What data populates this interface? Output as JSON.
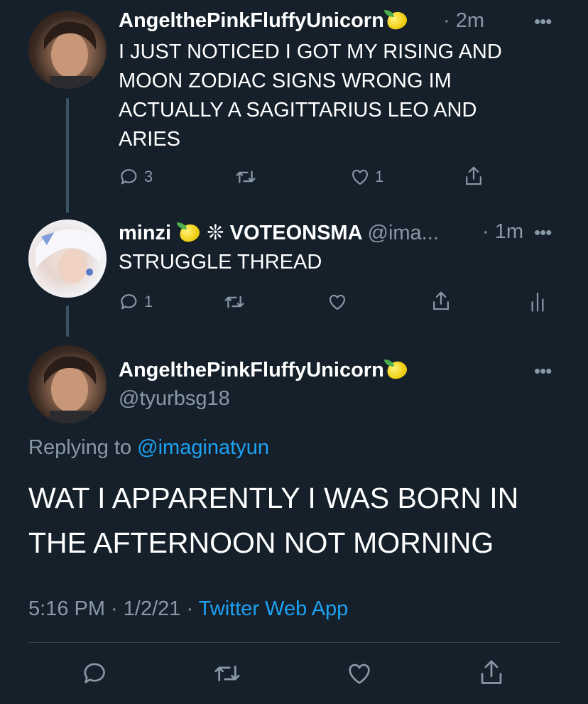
{
  "tweet1": {
    "display_name": "AngelthePinkFluffyUnicorn",
    "time": "· 2m",
    "text_lines": [
      "I JUST NOTICED I GOT MY RISING AND",
      "MOON ZODIAC SIGNS WRONG IM",
      "ACTUALLY A SAGITTARIUS LEO AND",
      "ARIES"
    ],
    "reply_count": "3",
    "like_count": "1"
  },
  "tweet2": {
    "display_name_a": "minzi",
    "display_name_b": "❊ VOTEONSMA",
    "handle": "@ima...",
    "time": "· 1m",
    "text": "STRUGGLE THREAD",
    "reply_count": "1"
  },
  "main_tweet": {
    "display_name": "AngelthePinkFluffyUnicorn",
    "handle": "@tyurbsg18",
    "replying_prefix": "Replying to",
    "replying_handle": "@imaginatyun",
    "text_lines": [
      "WAT I APPARENTLY I WAS BORN IN",
      "THE AFTERNOON NOT MORNING"
    ],
    "meta_time": "5:16 PM · 1/2/21 ·",
    "meta_source": "Twitter Web App"
  },
  "more_label": "•••",
  "colors": {
    "background": "#15202b",
    "muted": "#8899a6",
    "link": "#1da1f2",
    "thread_line": "#3d5466"
  },
  "icons": [
    "reply-icon",
    "retweet-icon",
    "like-icon",
    "share-icon",
    "analytics-icon",
    "more-icon",
    "lemon-emoji"
  ]
}
